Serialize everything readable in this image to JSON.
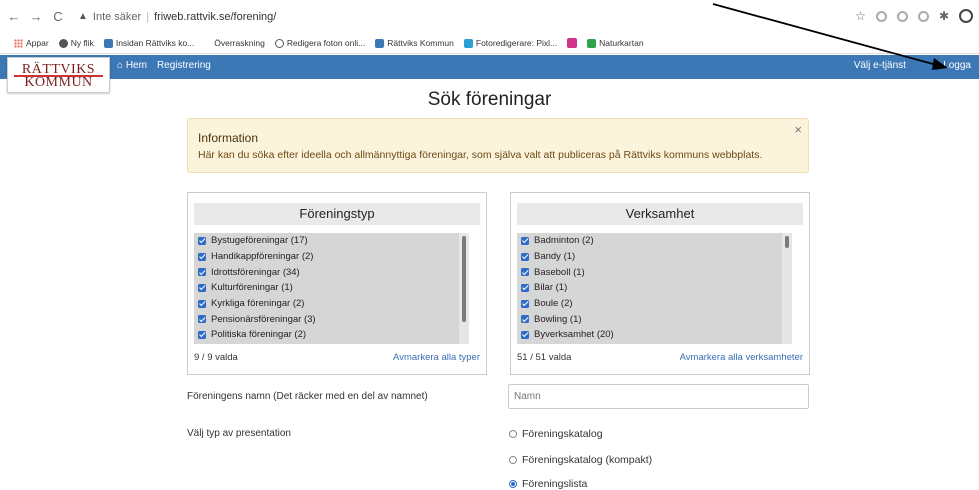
{
  "browser": {
    "security_label": "Inte säker",
    "url": "friweb.rattvik.se/forening/",
    "bookmarks": [
      "Appar",
      "Ny flik",
      "Insidan Rättviks ko...",
      "Överraskning",
      "Redigera foton onli...",
      "Rättviks Kommun",
      "Fotoredigerare: Pixl...",
      "Naturkartan"
    ]
  },
  "site": {
    "logo_line1": "RÄTTVIKS",
    "logo_line2": "KOMMUN",
    "nav": {
      "home": "Hem",
      "registration": "Registrering",
      "select_service": "Välj e-tjänst",
      "login": "Logga"
    }
  },
  "page": {
    "title": "Sök föreningar",
    "info": {
      "heading": "Information",
      "text": "Här kan du söka efter ideella och allmännyttiga föreningar, som själva valt att publiceras på Rättviks kommuns webbplats.",
      "close": "×"
    },
    "types_panel": {
      "heading": "Föreningstyp",
      "items": [
        "Bystugeföreningar (17)",
        "Handikappföreningar (2)",
        "Idrottsföreningar (34)",
        "Kulturföreningar (1)",
        "Kyrkliga föreningar (2)",
        "Pensionärsföreningar (3)",
        "Politiska föreningar (2)"
      ],
      "selected_count": "9 / 9 valda",
      "deselect_link": "Avmarkera alla typer"
    },
    "activity_panel": {
      "heading": "Verksamhet",
      "items": [
        "Badminton (2)",
        "Bandy (1)",
        "Baseboll (1)",
        "Bilar (1)",
        "Boule (2)",
        "Bowling (1)",
        "Byverksamhet (20)"
      ],
      "selected_count": "51 / 51 valda",
      "deselect_link": "Avmarkera alla verksamheter"
    },
    "name_label": "Föreningens namn (Det räcker med en del av namnet)",
    "name_placeholder": "Namn",
    "presentation_label": "Välj typ av presentation",
    "presentation_options": [
      "Föreningskatalog",
      "Föreningskatalog (kompakt)",
      "Föreningslista"
    ],
    "presentation_selected": "Föreningslista"
  },
  "colors": {
    "nav_bar": "#3b78b5",
    "alert_bg": "#fcf3dc",
    "checkbox": "#2f6dc4",
    "link": "#3b6fb5"
  }
}
